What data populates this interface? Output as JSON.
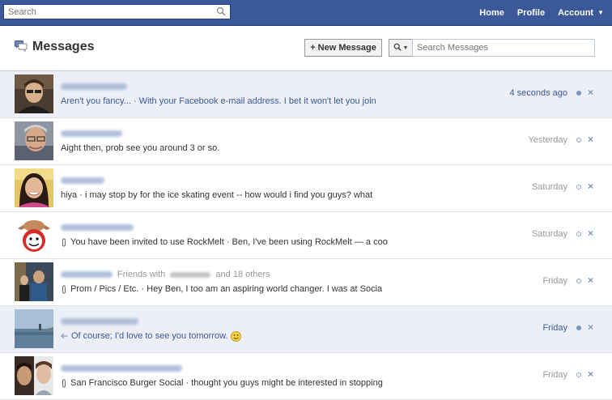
{
  "topbar": {
    "search_placeholder": "Search",
    "nav": [
      {
        "label": "Home"
      },
      {
        "label": "Profile"
      },
      {
        "label": "Account"
      }
    ]
  },
  "header": {
    "title": "Messages",
    "new_message_label": "+ New Message",
    "search_placeholder": "Search Messages"
  },
  "threads": [
    {
      "snippet": "Aren't you fancy... · With your Facebook e-mail address. I bet it won't let you join",
      "timestamp": "4 seconds ago",
      "unread": true
    },
    {
      "snippet": "Aight then, prob see you around 3 or so.",
      "timestamp": "Yesterday",
      "unread": false
    },
    {
      "snippet": "hiya · i may stop by for the ice skating event -- how would i find you guys? what",
      "timestamp": "Saturday",
      "unread": false
    },
    {
      "snippet": "You have been invited to use RockMelt · Ben, I've been using RockMelt — a coo",
      "timestamp": "Saturday",
      "unread": false,
      "attachment": true
    },
    {
      "snippet": "Prom / Pics / Etc. · Hey Ben, I too am an aspiring world changer. I was at Socia",
      "timestamp": "Friday",
      "unread": false,
      "attachment": true,
      "friends_prefix": "Friends with",
      "friends_suffix": "and 18 others"
    },
    {
      "snippet": "Of course; I'd love to see you tomorrow.",
      "timestamp": "Friday",
      "unread": true,
      "replied": true
    },
    {
      "snippet": "San Francisco Burger Social · thought you guys might be interested in stopping",
      "timestamp": "Friday",
      "unread": false,
      "attachment": true
    }
  ],
  "colors": {
    "topbar": "#3b5998",
    "unread_row": "#eceff5",
    "link": "#3b5998"
  }
}
